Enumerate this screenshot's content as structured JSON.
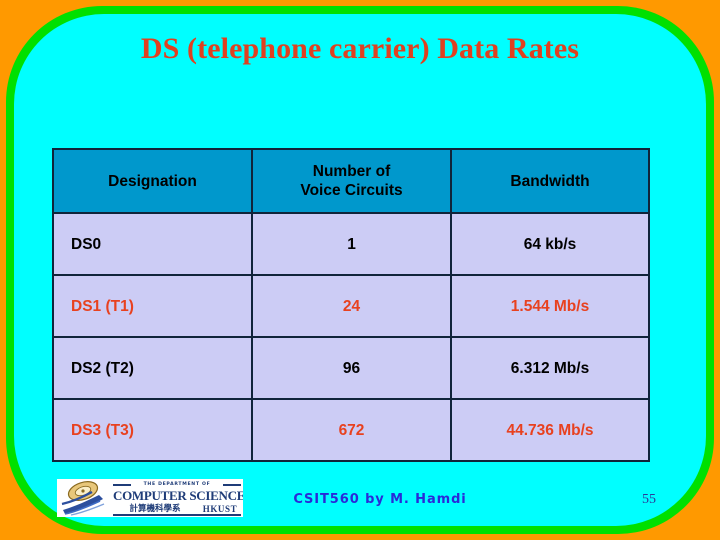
{
  "slide": {
    "title": "DS (telephone carrier) Data Rates",
    "background_color": "#FF9900",
    "frame_border_color": "#00E000",
    "canvas_color": "#00FFFF",
    "title_color": "#E04020"
  },
  "table": {
    "header_bg": "#0098CC",
    "cell_bg": "#CCCCF5",
    "border_color": "#10243A",
    "columns": [
      {
        "id": "designation",
        "label": "Designation"
      },
      {
        "id": "circuits",
        "label_line1": "Number of",
        "label_line2": "Voice Circuits"
      },
      {
        "id": "bandwidth",
        "label": "Bandwidth"
      }
    ],
    "rows": [
      {
        "designation": "DS0",
        "circuits": "1",
        "bandwidth": "64 kb/s",
        "text_color": "#000000"
      },
      {
        "designation": "DS1 (T1)",
        "circuits": "24",
        "bandwidth": "1.544 Mb/s",
        "text_color": "#E8411F"
      },
      {
        "designation": "DS2 (T2)",
        "circuits": "96",
        "bandwidth": "6.312 Mb/s",
        "text_color": "#000000"
      },
      {
        "designation": "DS3 (T3)",
        "circuits": "672",
        "bandwidth": "44.736 Mb/s",
        "text_color": "#E8411F"
      }
    ]
  },
  "footer": {
    "note": "CSIT560 by M. Hamdi",
    "note_color": "#2A2AD8",
    "page_number": "55",
    "page_number_color": "#2A3A9A"
  },
  "logo": {
    "dept_line": "THE DEPARTMENT OF",
    "main_line": "COMPUTER SCIENCE",
    "chinese_line": "計算機科學系",
    "institution": "HKUST",
    "color": "#1F3C78",
    "mark": "cs-disc-swoosh-logo"
  }
}
